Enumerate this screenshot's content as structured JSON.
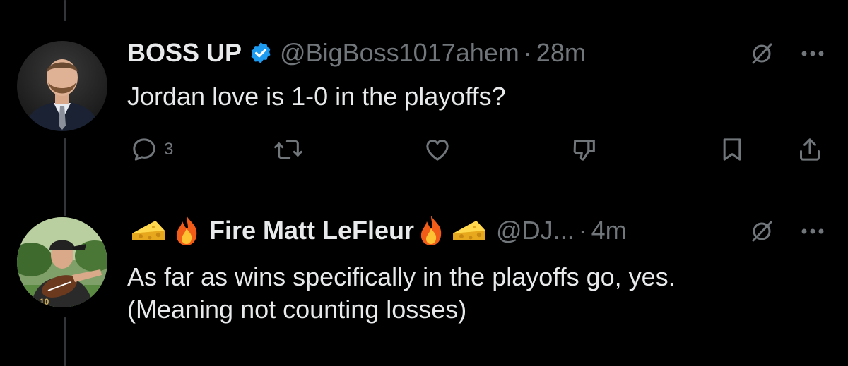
{
  "tweets": [
    {
      "display_name": "BOSS UP",
      "handle": "@BigBoss1017ahem",
      "separator": "·",
      "time": "28m",
      "text_lines": [
        "Jordan love is 1-0 in the playoffs?"
      ],
      "verified": true,
      "actions": {
        "reply_count": "3"
      }
    },
    {
      "display_name": "Fire Matt LeFleur",
      "name_emoji_left": [
        "cheese-icon",
        "fire-icon"
      ],
      "name_emoji_right": [
        "fire-icon",
        "cheese-icon"
      ],
      "handle": "@DJ...",
      "separator": "·",
      "time": "4m",
      "text_lines": [
        "As far as wins specifically in the playoffs go, yes.",
        "(Meaning not counting losses)"
      ]
    }
  ],
  "colors": {
    "background": "#000000",
    "primary_text": "#e7e9ea",
    "secondary_text": "#71767b",
    "verified_blue": "#1d9bf0",
    "thread_line": "#333639"
  }
}
